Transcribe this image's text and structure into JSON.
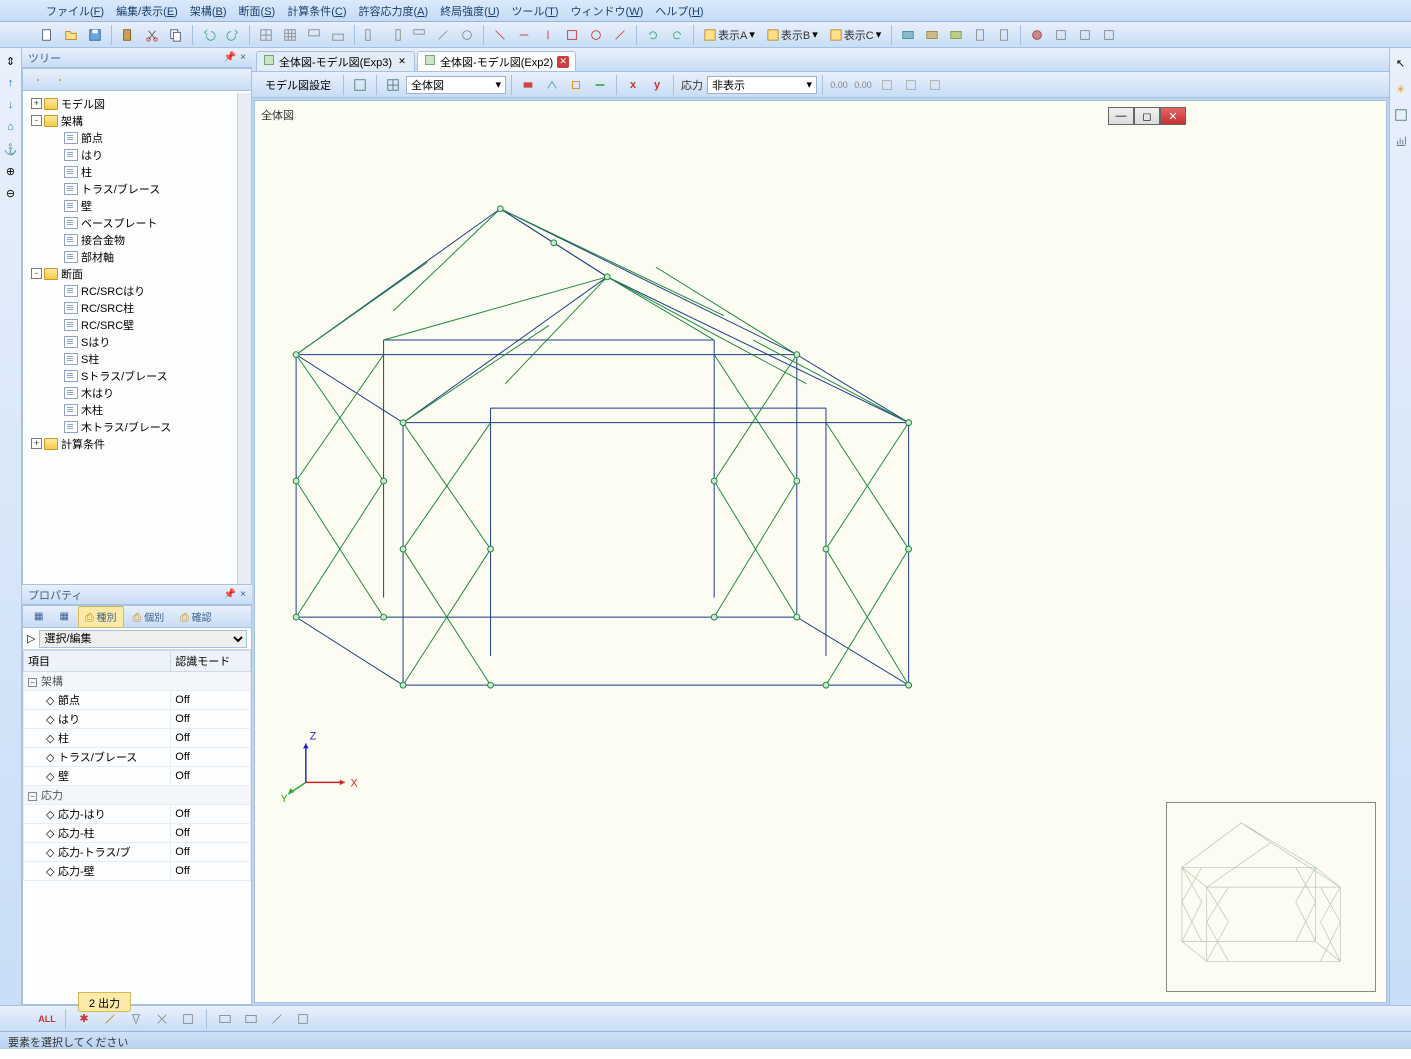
{
  "menubar": {
    "items": [
      {
        "label": "ファイル",
        "key": "F"
      },
      {
        "label": "編集/表示",
        "key": "E"
      },
      {
        "label": "架構",
        "key": "B"
      },
      {
        "label": "断面",
        "key": "S"
      },
      {
        "label": "計算条件",
        "key": "C"
      },
      {
        "label": "許容応力度",
        "key": "A"
      },
      {
        "label": "終局強度",
        "key": "U"
      },
      {
        "label": "ツール",
        "key": "T"
      },
      {
        "label": "ウィンドウ",
        "key": "W"
      },
      {
        "label": "ヘルプ",
        "key": "H"
      }
    ]
  },
  "toolbar_main": {
    "buttons": [
      "new",
      "open",
      "save",
      "sep",
      "paste",
      "cut",
      "copy",
      "sep",
      "undo",
      "redo",
      "sep",
      "grid1",
      "grid2",
      "grid3",
      "grid4",
      "sep",
      "view1",
      "view2",
      "view3",
      "view4",
      "view5",
      "sep",
      "tool1",
      "tool2",
      "tool3",
      "tool4",
      "tool5",
      "tool6",
      "sep",
      "color1",
      "color2",
      "color3",
      "color4",
      "color5"
    ],
    "display_a": "表示A",
    "display_b": "表示B",
    "display_c": "表示C"
  },
  "left_toolbar_icons": [
    "expand",
    "up",
    "down",
    "home",
    "anchor",
    "plus",
    "minus"
  ],
  "tree_panel": {
    "title": "ツリー",
    "toolbar_icons": [
      "folder1",
      "folder2"
    ],
    "nodes": [
      {
        "depth": 0,
        "exp": "+",
        "icon": "folder",
        "label": "モデル図"
      },
      {
        "depth": 0,
        "exp": "-",
        "icon": "folder",
        "label": "架構"
      },
      {
        "depth": 1,
        "exp": "",
        "icon": "item",
        "label": "節点"
      },
      {
        "depth": 1,
        "exp": "",
        "icon": "item",
        "label": "はり"
      },
      {
        "depth": 1,
        "exp": "",
        "icon": "item",
        "label": "柱"
      },
      {
        "depth": 1,
        "exp": "",
        "icon": "item",
        "label": "トラス/ブレース"
      },
      {
        "depth": 1,
        "exp": "",
        "icon": "item",
        "label": "壁"
      },
      {
        "depth": 1,
        "exp": "",
        "icon": "item",
        "label": "ベースプレート"
      },
      {
        "depth": 1,
        "exp": "",
        "icon": "item",
        "label": "接合金物"
      },
      {
        "depth": 1,
        "exp": "",
        "icon": "item",
        "label": "部材軸"
      },
      {
        "depth": 0,
        "exp": "-",
        "icon": "folder",
        "label": "断面"
      },
      {
        "depth": 1,
        "exp": "",
        "icon": "item",
        "label": "RC/SRCはり"
      },
      {
        "depth": 1,
        "exp": "",
        "icon": "item",
        "label": "RC/SRC柱"
      },
      {
        "depth": 1,
        "exp": "",
        "icon": "item",
        "label": "RC/SRC壁"
      },
      {
        "depth": 1,
        "exp": "",
        "icon": "item",
        "label": "Sはり"
      },
      {
        "depth": 1,
        "exp": "",
        "icon": "item",
        "label": "S柱"
      },
      {
        "depth": 1,
        "exp": "",
        "icon": "item",
        "label": "Sトラス/ブレース"
      },
      {
        "depth": 1,
        "exp": "",
        "icon": "item",
        "label": "木はり"
      },
      {
        "depth": 1,
        "exp": "",
        "icon": "item",
        "label": "木柱"
      },
      {
        "depth": 1,
        "exp": "",
        "icon": "item",
        "label": "木トラス/ブレース"
      },
      {
        "depth": 0,
        "exp": "+",
        "icon": "folder",
        "label": "計算条件"
      }
    ]
  },
  "property_panel": {
    "title": "プロパティ",
    "tabs": [
      {
        "label": "",
        "icon": "t1"
      },
      {
        "label": "",
        "icon": "t2"
      },
      {
        "label": "種別",
        "active": true
      },
      {
        "label": "個別"
      },
      {
        "label": "確認"
      }
    ],
    "selector_label": "選択/編集",
    "columns": [
      "項目",
      "認識モード"
    ],
    "groups": [
      {
        "name": "架構",
        "rows": [
          {
            "label": "節点",
            "value": "Off"
          },
          {
            "label": "はり",
            "value": "Off"
          },
          {
            "label": "柱",
            "value": "Off"
          },
          {
            "label": "トラス/ブレース",
            "value": "Off"
          },
          {
            "label": "壁",
            "value": "Off"
          }
        ]
      },
      {
        "name": "応力",
        "rows": [
          {
            "label": "応力-はり",
            "value": "Off"
          },
          {
            "label": "応力-柱",
            "value": "Off"
          },
          {
            "label": "応力-トラス/ブ",
            "value": "Off"
          },
          {
            "label": "応力-壁",
            "value": "Off"
          }
        ]
      }
    ]
  },
  "doc_tabs": [
    {
      "label": "全体図-モデル図(Exp3)",
      "active": false,
      "close_style": "x"
    },
    {
      "label": "全体図-モデル図(Exp2)",
      "active": true,
      "close_style": "red"
    }
  ],
  "doc_toolbar": {
    "settings_label": "モデル図設定",
    "view_combo": "全体図",
    "stress_label": "応力",
    "stress_combo": "非表示"
  },
  "canvas": {
    "title": "全体図",
    "axes": {
      "x": "X",
      "y": "Y",
      "z": "Z"
    }
  },
  "bottom_tab": {
    "label": "2 出力"
  },
  "statusbar": {
    "text": "要素を選択してください"
  }
}
